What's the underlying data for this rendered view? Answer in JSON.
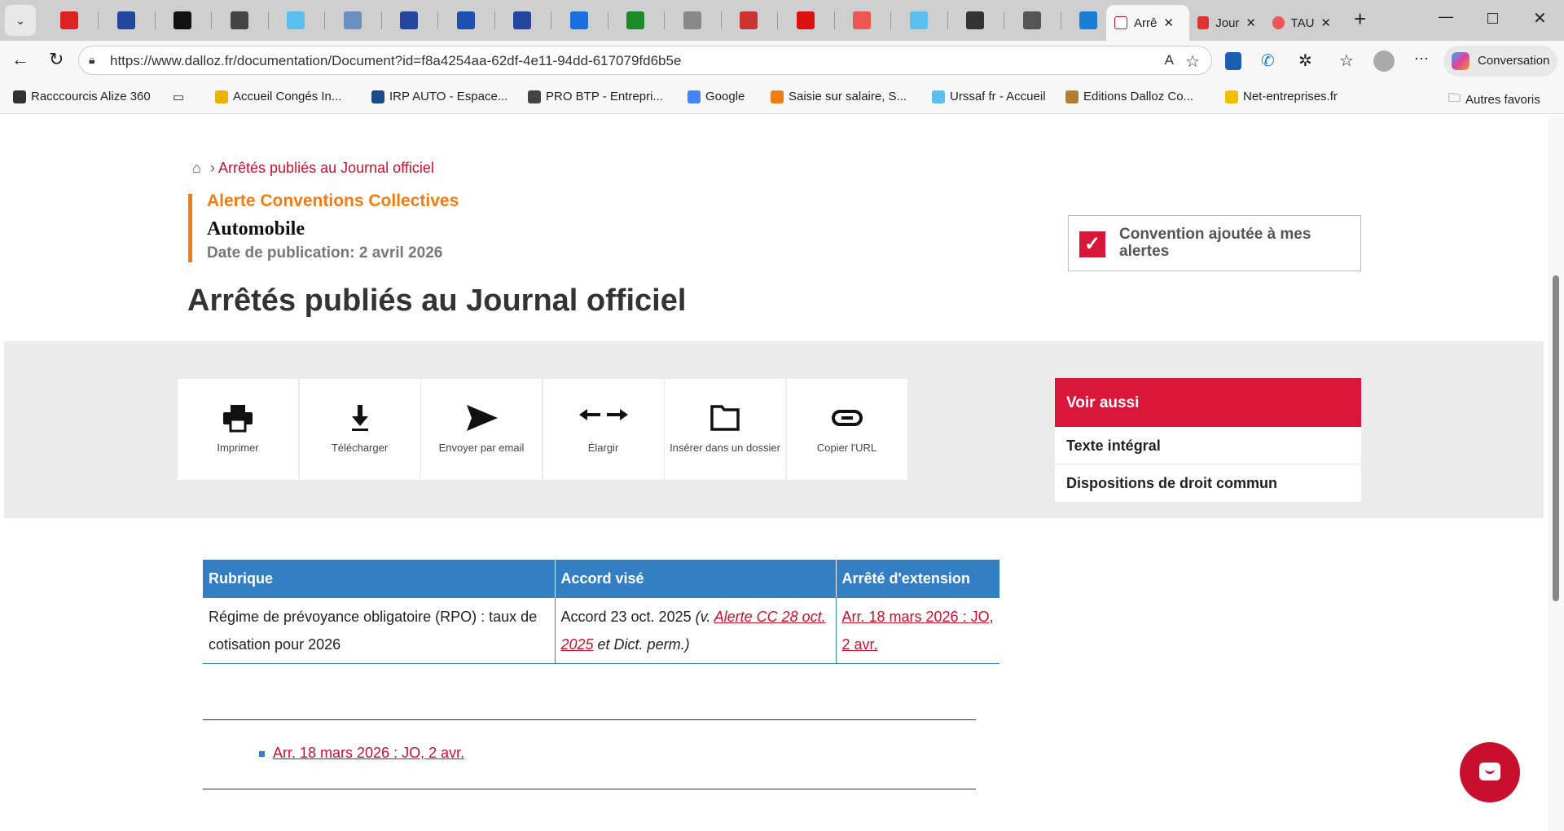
{
  "browser": {
    "tabs": [
      {
        "label": "Arrê",
        "active": true
      },
      {
        "label": "Jour"
      },
      {
        "label": "TAU"
      }
    ],
    "url": "https://www.dalloz.fr/documentation/Document?id=f8a4254aa-62df-4e11-94dd-617079fd6b5e",
    "conversation_label": "Conversation",
    "bookmarks": [
      "Racccourcis Alize 360",
      "Accueil  Congés In...",
      "IRP AUTO - Espace...",
      "PRO BTP - Entrepri...",
      "Google",
      "Saisie sur salaire, S...",
      "Urssaf fr - Accueil",
      "Editions Dalloz  Co...",
      "Net-entreprises.fr"
    ],
    "other_favorites": "Autres favoris"
  },
  "page": {
    "breadcrumb": "Arrêtés publiés au Journal officiel",
    "alert_title": "Alerte Conventions Collectives",
    "subject": "Automobile",
    "pub_date": "Date de publication: 2 avril 2026",
    "convention_added": "Convention ajoutée à mes alertes",
    "title": "Arrêtés publiés au Journal officiel",
    "tools": [
      "Imprimer",
      "Télécharger",
      "Envoyer par email",
      "Élargir",
      "Insérer dans un dossier",
      "Copier l'URL"
    ],
    "see_also": {
      "title": "Voir aussi",
      "items": [
        "Texte intégral",
        "Dispositions de droit commun"
      ]
    },
    "table": {
      "headers": [
        "Rubrique",
        "Accord visé",
        "Arrêté d'extension"
      ],
      "row": {
        "rubrique": "Régime de prévoyance obligatoire (RPO) : taux de cotisation pour 2026",
        "accord_prefix": "Accord 23 oct. 2025 ",
        "accord_v": "(v. ",
        "accord_link": "Alerte CC 28 oct. 2025",
        "accord_suffix": " et Dict. perm.)",
        "arrete_link": "Arr. 18 mars 2026 : JO, 2 avr."
      }
    },
    "list_link": "Arr. 18 mars 2026 : JO, 2 avr."
  },
  "colors": {
    "red": "#d9173a",
    "orange": "#f07c14",
    "blue": "#347ec4"
  }
}
